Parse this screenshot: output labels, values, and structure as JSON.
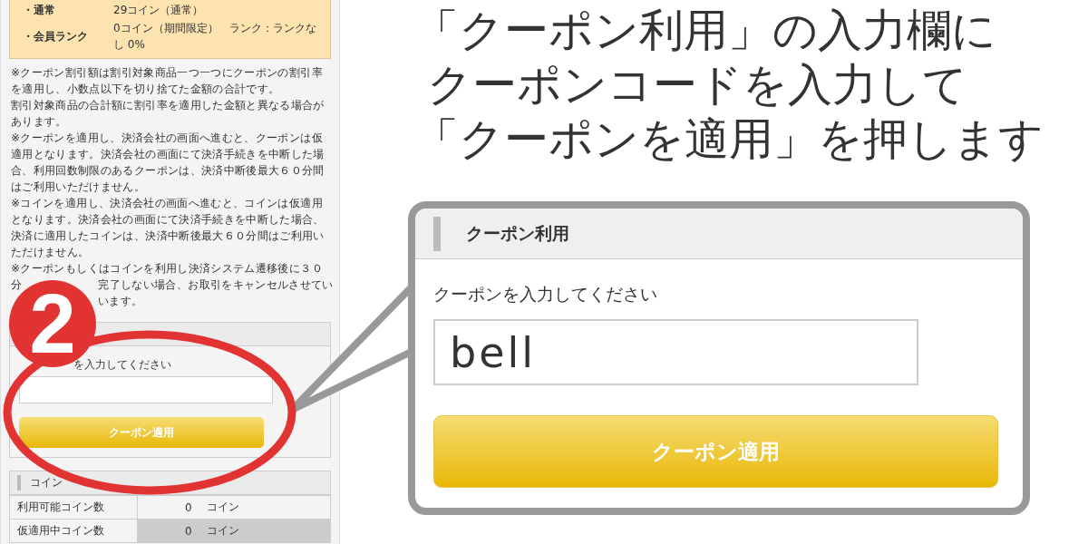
{
  "member_info": {
    "rows": [
      {
        "label": "・通常",
        "value": "29コイン（通常）"
      },
      {
        "label": "・会員ランク",
        "value": "0コイン（期間限定）　ランク：ランクなし 0%"
      }
    ]
  },
  "notes": [
    "※クーポン割引額は割引対象商品一つ一つにクーポンの割引率",
    "を適用し、小数点以下を切り捨てた金額の合計です。",
    "割引対象商品の合計額に割引率を適用した金額と異なる場合が",
    "あります。",
    "※クーポンを適用し、決済会社の画面へ進むと、クーポンは仮",
    "適用となります。決済会社の画面にて決済手続きを中断した場",
    "合、利用回数制限のあるクーポンは、決済中断後最大６０分間",
    "はご利用いただけません。",
    "※コインを適用し、決済会社の画面へ進むと、コインは仮適用",
    "となります。決済会社の画面にて決済手続きを中断した場合、",
    "決済に適用したコインは、決済中断後最大６０分間はご利用い",
    "ただけません。",
    "※クーポンもしくはコインを利用し決済システム遷移後に３０"
  ],
  "notes_partial": [
    {
      "visible_start": "分",
      "visible_rest": "完了しない場合、お取引をキャンセルさせてい"
    },
    {
      "visible_rest": "います。"
    }
  ],
  "coupon_panel": {
    "label": "を入力してください",
    "button": "クーポン適用"
  },
  "coin_panel": {
    "title": "コイン",
    "rows": [
      {
        "label": "利用可能コイン数",
        "value": "0",
        "unit": "コイン",
        "highlighted": false
      },
      {
        "label": "仮適用中コイン数",
        "value": "0",
        "unit": "コイン",
        "highlighted": true
      }
    ]
  },
  "step_badge": "2",
  "instruction": [
    "「クーポン利用」の入力欄に",
    "クーポンコードを入力して",
    "「クーポンを適用」を押します"
  ],
  "callout": {
    "title": "クーポン利用",
    "label": "クーポンを入力してください",
    "value": "bell",
    "button": "クーポン適用"
  }
}
